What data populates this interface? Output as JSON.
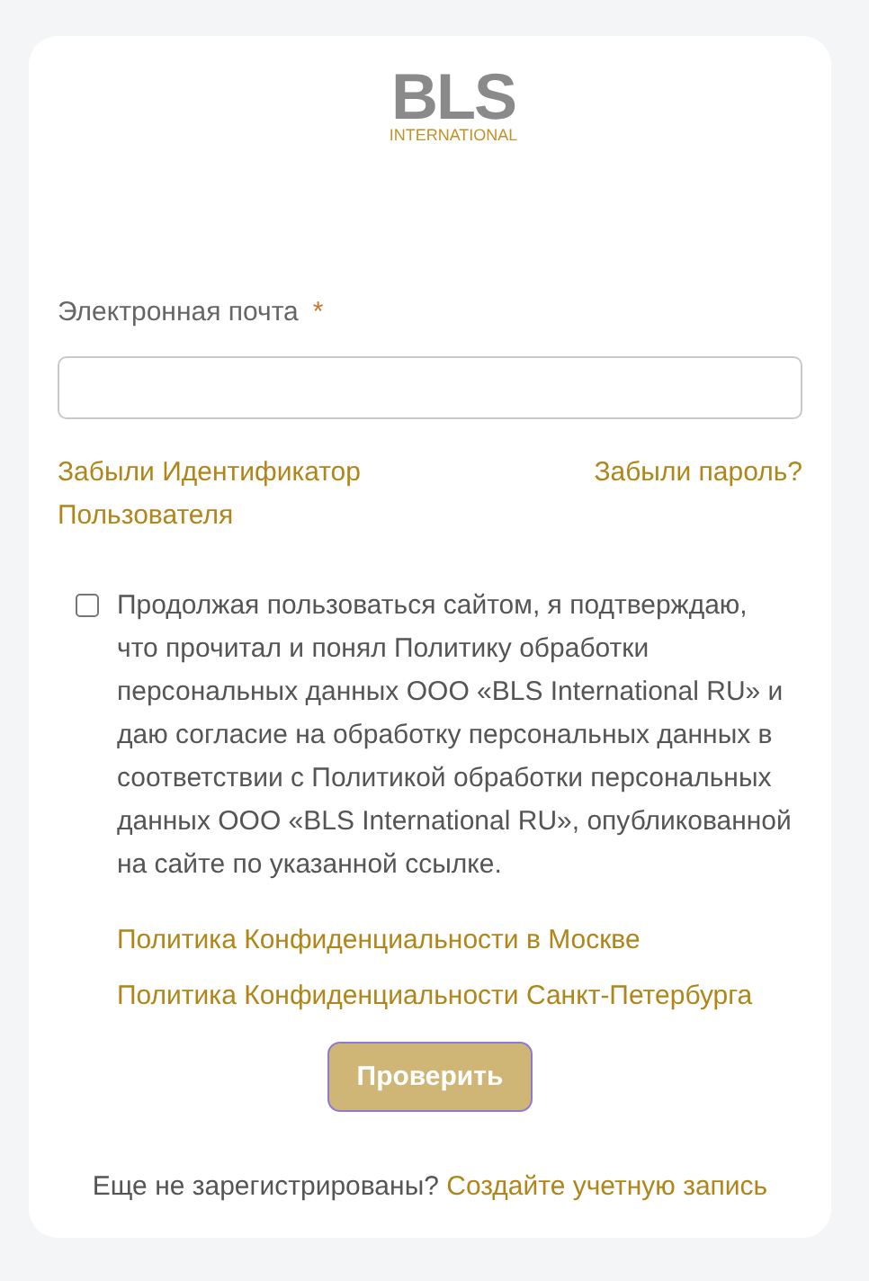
{
  "logo": {
    "wordmark": "BLS",
    "subtitle": "INTERNATIONAL"
  },
  "email": {
    "label": "Электронная почта",
    "required_mark": "*"
  },
  "links": [
    "Забыли Идентификатор Пользователя",
    "Забыли пароль?"
  ],
  "consent": {
    "checked": false,
    "text": "Продолжая пользоваться сайтом, я подтверждаю, что прочитал и понял Политику обработки персональных данных ООО «BLS International RU» и даю согласие на обработку персональных данных в соответствии с Политикой обработки персональных данных ООО «BLS International RU», опубликованной на сайте по указанной ссылке."
  },
  "policy_links": [
    "Политика Конфиденциальности в Москве",
    "Политика Конфиденциальности Санкт-Петербурга"
  ],
  "submit": "Проверить",
  "footer": {
    "text": "Еще не зарегистрированы?",
    "link": "Создайте учетную запись"
  }
}
